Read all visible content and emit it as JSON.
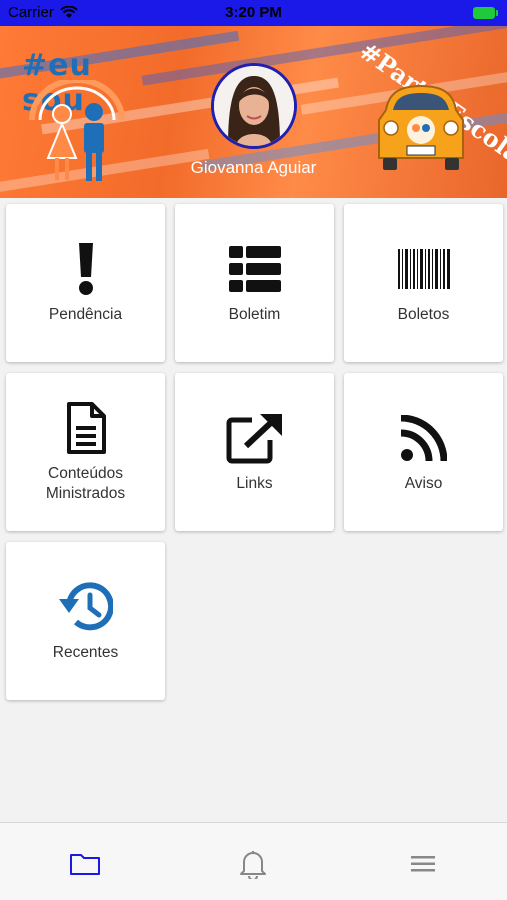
{
  "status_bar": {
    "carrier": "Carrier",
    "time": "3:20 PM"
  },
  "banner": {
    "left_tag": "#eu sou",
    "right_tag": "#PartiuEscola",
    "student_name": "Giovanna Aguiar"
  },
  "tiles": [
    {
      "label": "Pendência",
      "icon": "exclamation-icon"
    },
    {
      "label": "Boletim",
      "icon": "table-list-icon"
    },
    {
      "label": "Boletos",
      "icon": "barcode-icon"
    },
    {
      "label": "Conteúdos\nMinistrados",
      "icon": "document-icon"
    },
    {
      "label": "Links",
      "icon": "external-link-icon"
    },
    {
      "label": "Aviso",
      "icon": "rss-icon"
    },
    {
      "label": "Recentes",
      "icon": "history-icon"
    }
  ],
  "bottom_nav": [
    {
      "name": "folder",
      "active": true
    },
    {
      "name": "notifications",
      "active": false
    },
    {
      "name": "menu",
      "active": false
    }
  ],
  "colors": {
    "status_bar": "#1a19e8",
    "banner": "#f26b2a",
    "accent": "#1f6fb8",
    "nav_active": "#1a19e8"
  }
}
